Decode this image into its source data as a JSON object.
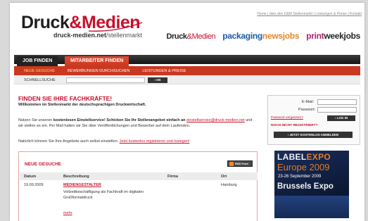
{
  "logo": {
    "druck": "Druck",
    "amp": "&",
    "medien": "Medien",
    "url_prefix": "druck-medien.net",
    "url_suffix": "/stellenmarkt"
  },
  "toplinks": "Home | über den D&M Stellenmarkt | Leistungen & Preise | Kontakt",
  "partners": {
    "dm_druck": "Druck",
    "dm_amp": "&",
    "dm_medien": "Medien",
    "packaging_a": "packaging",
    "packaging_b": "newsjobs",
    "print_a": "print",
    "print_b": "weekjobs"
  },
  "nav": {
    "tab_job": "JOB FINDEN",
    "tab_mitarbeiter": "MITARBEITER FINDEN"
  },
  "subnav": [
    "NEUE GESUCHE",
    "BEWERBUNGEN DURCHSUCHEN",
    "LEISTUNGEN & PREISE"
  ],
  "search": {
    "label": "SCHNELLSUCHE",
    "button": "OK"
  },
  "main": {
    "headline": "FINDEN SIE IHRE FACHKRÄFTE!",
    "welcome": "Willkommen im Stellenmarkt der deutschsprachigen Druckwirtschaft.",
    "intro_a": "Nutzen Sie unseren ",
    "intro_b": "kostenlosen Einstellservice! Schicken Sie Ihr Stellenangebot einfach an",
    "intro_link": "einstellservice@druck-medien.net",
    "intro_c": " und wir stellen es ein. Per Mail halten wir Sie über Veröffentlichungen und Bewerber auf dem Laufenden.",
    "intro2_a": "Natürlich können Sie Ihre Angebote auch selbst einstellen.",
    "intro2_link": "Jetzt kostenlos registrieren und loslegen!"
  },
  "jobs": {
    "title": "NEUE GESUCHE",
    "rss": "RSS Feed",
    "columns": [
      "Datum",
      "Beschreibung",
      "Firma",
      "Ort"
    ],
    "rows": [
      {
        "date": "19.09.2009",
        "title": "MEDIENGESTALTER",
        "desc": "Vollzeitbeschäftigung als Fachkraft im digitalen Großformatdruck",
        "firma": "",
        "ort": "Hamburg",
        "more": "mehr"
      }
    ]
  },
  "login": {
    "email_label": "E-Mail:",
    "password_label": "Passwort:",
    "forgot": "Passwort vergessen?",
    "login_btn": "LOG IN",
    "not_registered": "NOCH NICHT REGISTRIERT?",
    "register_btn": "JETZT KOSTENLOS ANMELDEN"
  },
  "banner": {
    "label": "LABEL",
    "expo": "EXPO",
    "europe": "Europe 2009",
    "dates": "23-26 September 2009",
    "city": "Brussels Expo"
  },
  "colors": {
    "brand_red": "#c8102e",
    "nav_red": "#c93820",
    "nav_dark": "#222222",
    "banner_blue": "#1b2d5c",
    "banner_orange": "#e07d2a"
  }
}
